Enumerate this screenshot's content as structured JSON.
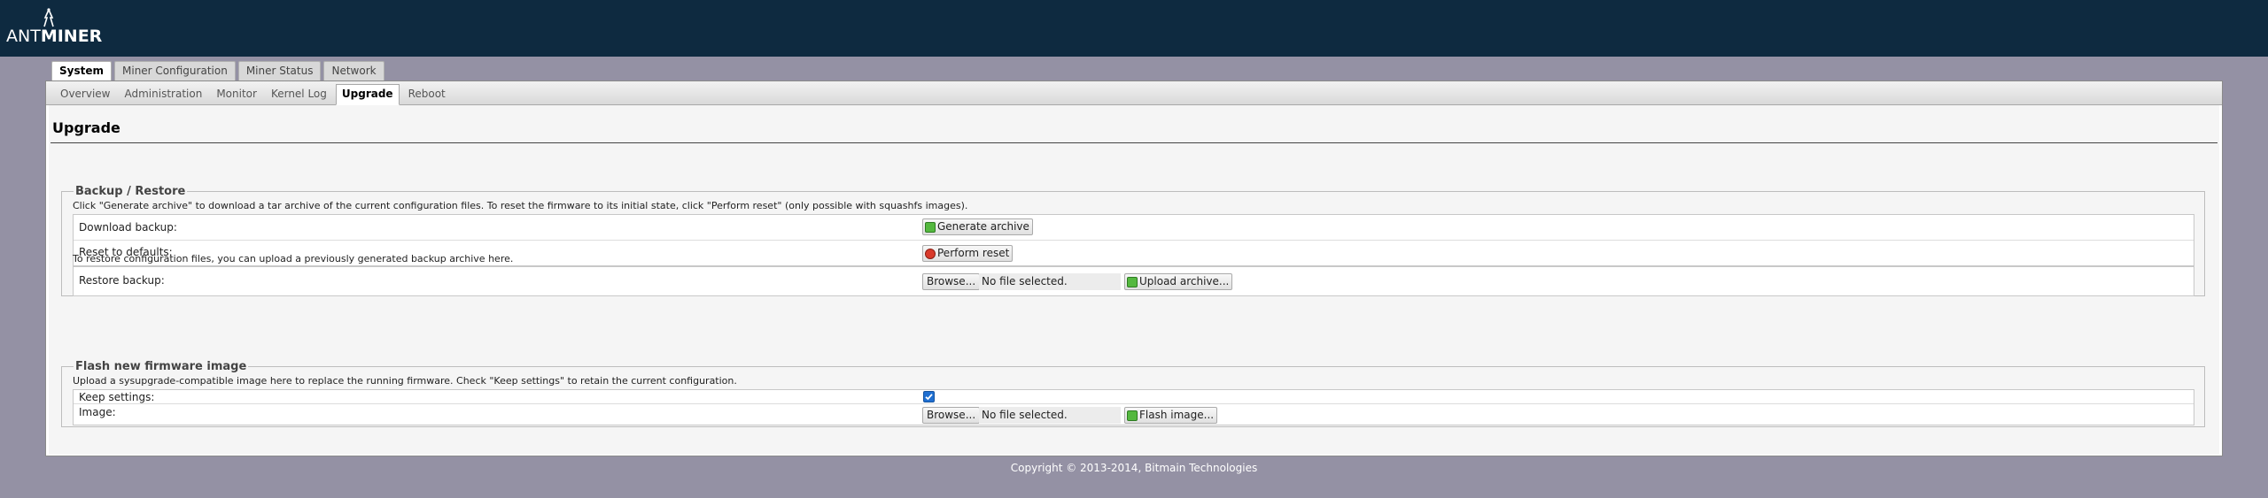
{
  "brand": {
    "logo_part1": "ANT",
    "logo_part2": "MINER"
  },
  "colors": {
    "header_bg": "#0e2a40",
    "page_bg": "#9491a4",
    "accent_checkbox": "#1f6fd1"
  },
  "primary_tabs": [
    {
      "label": "System",
      "active": true
    },
    {
      "label": "Miner Configuration",
      "active": false
    },
    {
      "label": "Miner Status",
      "active": false
    },
    {
      "label": "Network",
      "active": false
    }
  ],
  "sub_tabs": [
    {
      "label": "Overview",
      "active": false
    },
    {
      "label": "Administration",
      "active": false
    },
    {
      "label": "Monitor",
      "active": false
    },
    {
      "label": "Kernel Log",
      "active": false
    },
    {
      "label": "Upgrade",
      "active": true
    },
    {
      "label": "Reboot",
      "active": false
    }
  ],
  "page": {
    "title": "Upgrade"
  },
  "backup": {
    "legend": "Backup / Restore",
    "description": "Click \"Generate archive\" to download a tar archive of the current configuration files. To reset the firmware to its initial state, click \"Perform reset\" (only possible with squashfs images).",
    "download_label": "Download backup:",
    "generate_button": "Generate archive",
    "reset_label": "Reset to defaults:",
    "reset_button": "Perform reset",
    "restore_description": "To restore configuration files, you can upload a previously generated backup archive here.",
    "restore_label": "Restore backup:",
    "browse_button": "Browse...",
    "file_status": "No file selected.",
    "upload_button": "Upload archive..."
  },
  "flash": {
    "legend": "Flash new firmware image",
    "description": "Upload a sysupgrade-compatible image here to replace the running firmware. Check \"Keep settings\" to retain the current configuration.",
    "keep_label": "Keep settings:",
    "keep_checked": true,
    "image_label": "Image:",
    "browse_button": "Browse...",
    "file_status": "No file selected.",
    "flash_button": "Flash image..."
  },
  "footer": {
    "text": "Copyright © 2013-2014, Bitmain Technologies"
  },
  "icons": [
    "logo-mark-icon",
    "archive-icon",
    "reset-icon",
    "upload-icon",
    "flash-icon",
    "checkbox-checked-icon"
  ]
}
